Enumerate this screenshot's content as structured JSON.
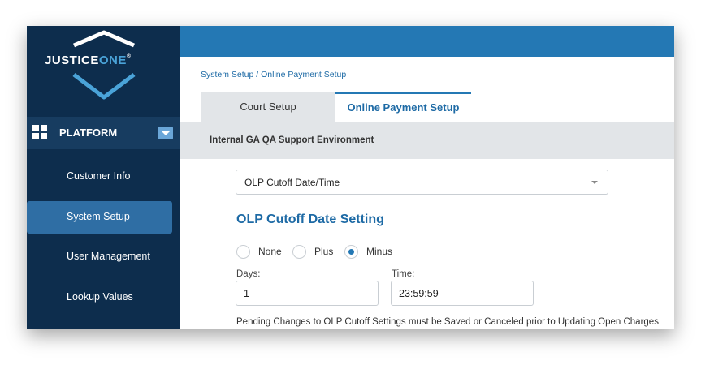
{
  "brand": {
    "part1": "JUSTICE",
    "part2": "ONE",
    "mark": "®"
  },
  "sidebar": {
    "section_label": "PLATFORM",
    "section_icon": "grid-icon",
    "items": [
      {
        "label": "Customer Info",
        "active": false
      },
      {
        "label": "System Setup",
        "active": true
      },
      {
        "label": "User Management",
        "active": false
      },
      {
        "label": "Lookup Values",
        "active": false
      }
    ]
  },
  "breadcrumb": "System Setup / Online Payment Setup",
  "tabs": [
    {
      "label": "Court Setup",
      "active": false
    },
    {
      "label": "Online Payment Setup",
      "active": true
    }
  ],
  "environment_label": "Internal GA QA Support Environment",
  "setting_select": {
    "value": "OLP Cutoff Date/Time"
  },
  "section_title": "OLP Cutoff Date Setting",
  "radios": [
    {
      "label": "None",
      "checked": false
    },
    {
      "label": "Plus",
      "checked": false
    },
    {
      "label": "Minus",
      "checked": true
    }
  ],
  "days": {
    "label": "Days:",
    "value": "1"
  },
  "time": {
    "label": "Time:",
    "value": "23:59:59"
  },
  "note": "Pending Changes to OLP Cutoff Settings must be Saved or Canceled prior to Updating Open Charges",
  "colors": {
    "sidebar": "#0d2d4d",
    "accent": "#2478b4",
    "active_nav": "#2f6ea4"
  }
}
